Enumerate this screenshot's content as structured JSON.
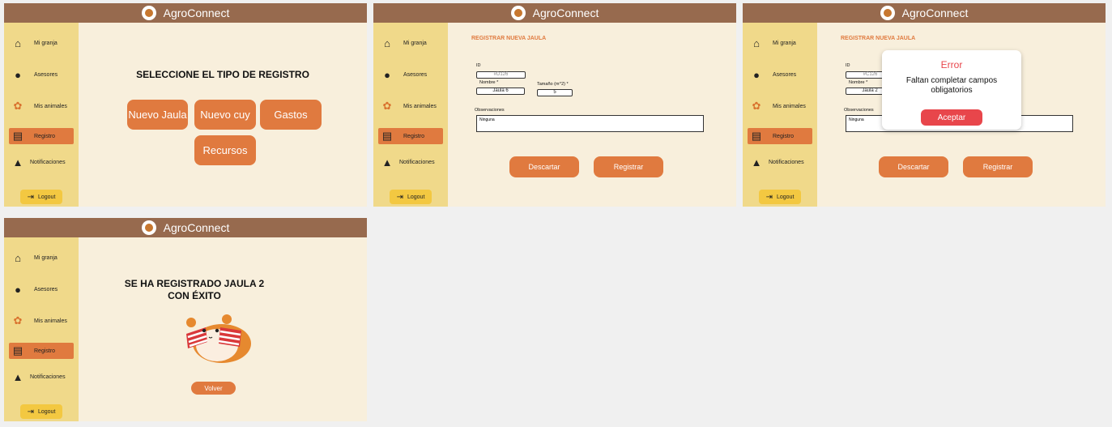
{
  "app": {
    "title": "AgroConnect"
  },
  "sidebar": {
    "items": [
      {
        "label": "Mi granja",
        "icon": "barn-icon"
      },
      {
        "label": "Asesores",
        "icon": "hat-icon"
      },
      {
        "label": "Mis animales",
        "icon": "guinea-pig-icon"
      },
      {
        "label": "Registro",
        "icon": "clipboard-icon"
      },
      {
        "label": "Notificaciones",
        "icon": "bell-icon"
      }
    ],
    "logout": "Logout",
    "active": "Registro"
  },
  "screen1": {
    "heading": "SELECCIONE EL TIPO DE REGISTRO",
    "buttons": {
      "jaula": "Nuevo Jaula",
      "cuy": "Nuevo cuy",
      "gastos": "Gastos",
      "recursos": "Recursos"
    }
  },
  "form": {
    "title": "REGISTRAR NUEVA JAULA",
    "id_label": "ID",
    "name_label": "Nombre *",
    "size_label": "Tamaño (m^2) *",
    "obs_label": "Observaciones",
    "discard": "Descartar",
    "submit": "Registrar"
  },
  "screen2": {
    "id_placeholder": "#D126",
    "name_value": "Jaula 6",
    "size_value": "5",
    "obs_value": "Ninguna"
  },
  "screen3": {
    "id_placeholder": "#C126",
    "name_value": "Jaula 2",
    "obs_value": "Ninguna",
    "modal": {
      "title": "Error",
      "message": "Faltan completar campos obligatorios",
      "button": "Aceptar"
    }
  },
  "screen4": {
    "message": "SE HA REGISTRADO JAULA 2 CON ÉXITO",
    "back": "Volver"
  },
  "colors": {
    "topbar": "#976a4e",
    "sidebar": "#f0d98a",
    "background": "#f8efdc",
    "accent": "#e07a3f",
    "logout": "#f3c841",
    "error": "#e8464b"
  }
}
